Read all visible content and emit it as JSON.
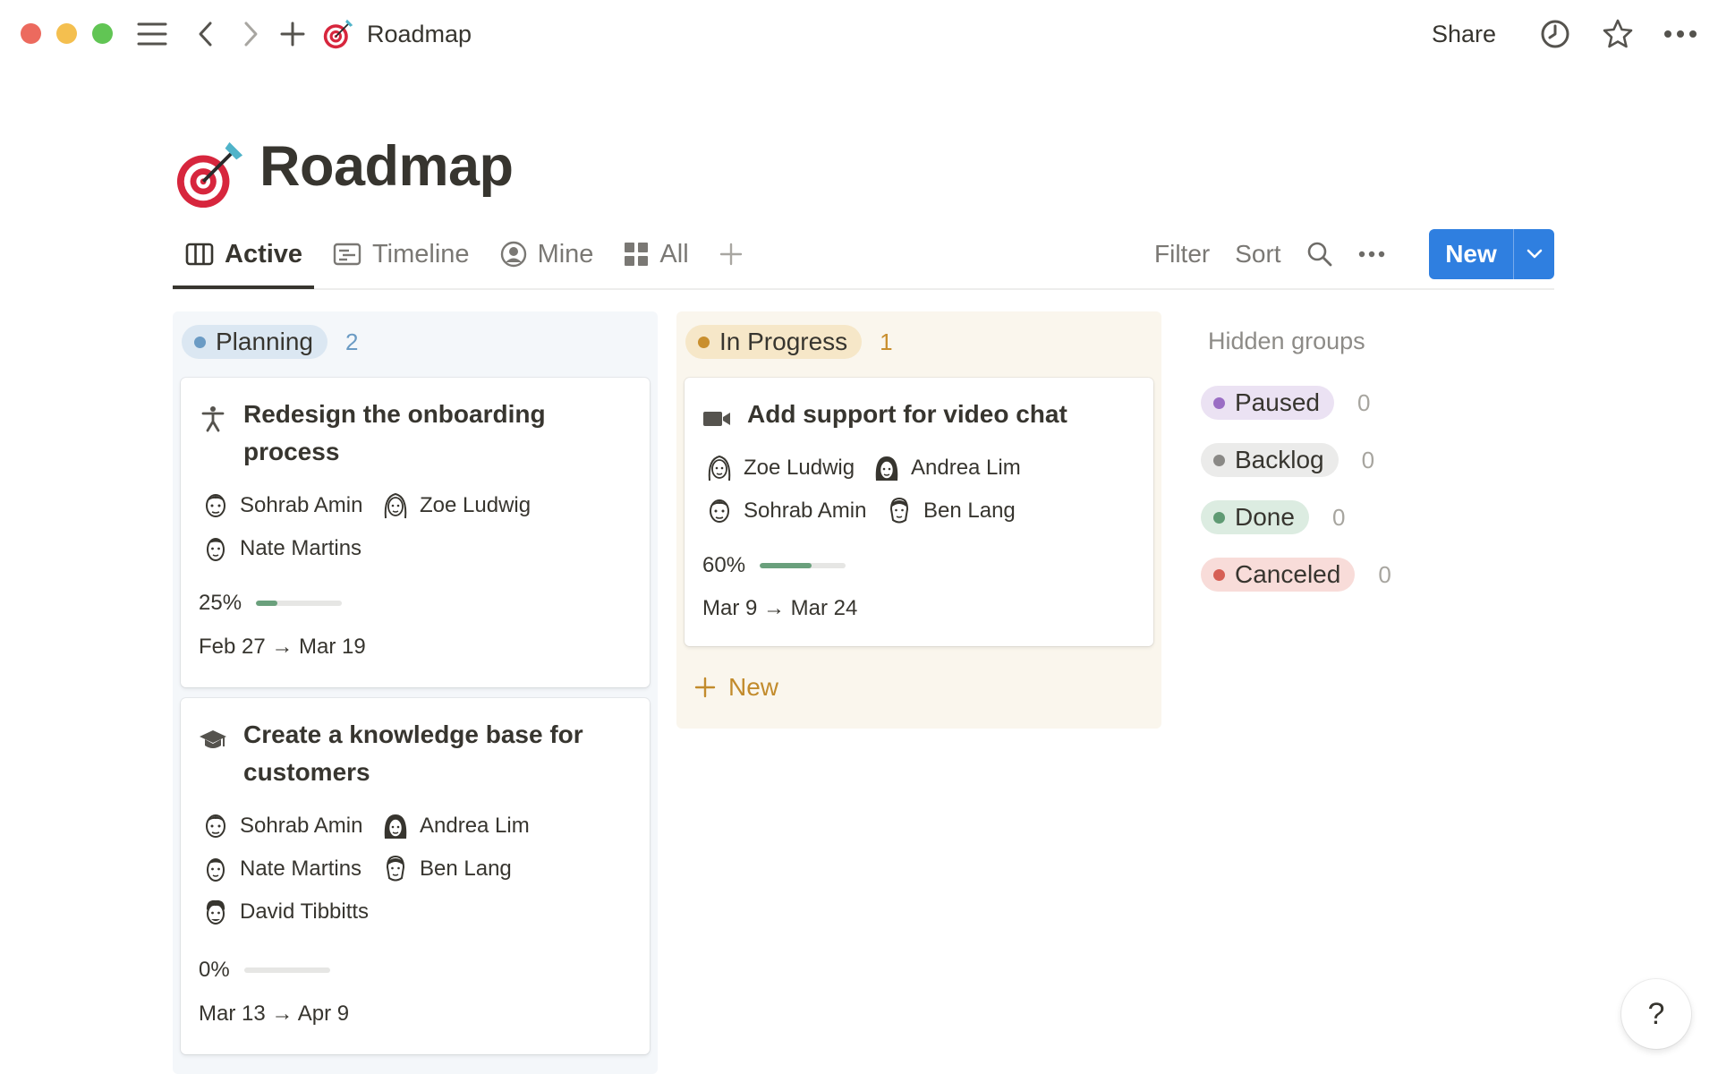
{
  "window": {
    "breadcrumb_title": "Roadmap",
    "share_label": "Share"
  },
  "page": {
    "icon": "dart-target-icon",
    "title": "Roadmap"
  },
  "tabs": [
    {
      "label": "Active",
      "icon": "board-view-icon",
      "active": true
    },
    {
      "label": "Timeline",
      "icon": "timeline-view-icon",
      "active": false
    },
    {
      "label": "Mine",
      "icon": "user-circle-icon",
      "active": false
    },
    {
      "label": "All",
      "icon": "grid-view-icon",
      "active": false
    }
  ],
  "toolbar": {
    "filter_label": "Filter",
    "sort_label": "Sort",
    "new_label": "New"
  },
  "columns": {
    "planning": {
      "label": "Planning",
      "count": "2",
      "color": "#6b9bc4",
      "pill_bg": "#dbe7f2",
      "count_color": "#6b9bc4",
      "cards": [
        {
          "icon": "accessibility-icon",
          "title_line1": "Redesign the onboarding",
          "title_line2": "process",
          "people": [
            "Sohrab Amin",
            "Zoe Ludwig",
            "Nate Martins"
          ],
          "progress_label": "25%",
          "progress": 0.25,
          "dates": "Feb 27 → Mar 19"
        },
        {
          "icon": "graduation-cap-icon",
          "title_line1": "Create a knowledge base for",
          "title_line2": "customers",
          "people": [
            "Sohrab Amin",
            "Andrea Lim",
            "Nate Martins",
            "Ben Lang",
            "David Tibbitts"
          ],
          "progress_label": "0%",
          "progress": 0,
          "dates": "Mar 13 → Apr 9"
        }
      ]
    },
    "in_progress": {
      "label": "In Progress",
      "count": "1",
      "color": "#c98f2e",
      "pill_bg": "#f6e7c8",
      "count_color": "#c98f2e",
      "cards": [
        {
          "icon": "video-camera-icon",
          "title_line1": "Add support for video chat",
          "people": [
            "Zoe Ludwig",
            "Andrea Lim",
            "Sohrab Amin",
            "Ben Lang"
          ],
          "progress_label": "60%",
          "progress": 0.6,
          "dates": "Mar 9 → Mar 24"
        }
      ],
      "new_label": "New"
    }
  },
  "hidden_groups": {
    "title": "Hidden groups",
    "groups": [
      {
        "label": "Paused",
        "count": "0",
        "color": "#9a6dc4",
        "bg": "#ebe2f3"
      },
      {
        "label": "Backlog",
        "count": "0",
        "color": "#8a8986",
        "bg": "#ebebea"
      },
      {
        "label": "Done",
        "count": "0",
        "color": "#5f9a73",
        "bg": "#dcece1"
      },
      {
        "label": "Canceled",
        "count": "0",
        "color": "#d65f55",
        "bg": "#f8dcd9"
      }
    ]
  },
  "help": {
    "label": "?"
  }
}
